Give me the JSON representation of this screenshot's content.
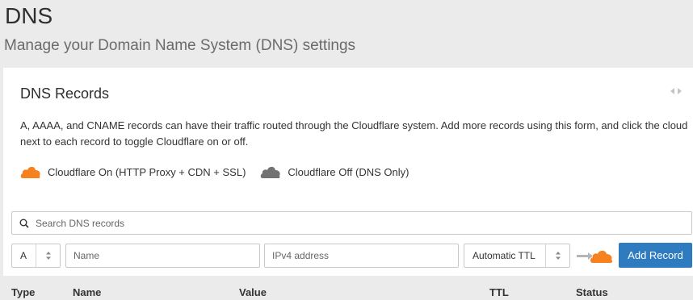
{
  "page": {
    "title": "DNS",
    "subtitle": "Manage your Domain Name System (DNS) settings"
  },
  "card": {
    "title": "DNS Records",
    "description": "A, AAAA, and CNAME records can have their traffic routed through the Cloudflare system. Add more records using this form, and click the cloud next to each record to toggle Cloudflare on or off.",
    "legend_on": "Cloudflare On (HTTP Proxy + CDN + SSL)",
    "legend_off": "Cloudflare Off (DNS Only)"
  },
  "search": {
    "placeholder": "Search DNS records"
  },
  "form": {
    "type_value": "A",
    "name_placeholder": "Name",
    "value_placeholder": "IPv4 address",
    "ttl_value": "Automatic TTL",
    "add_label": "Add Record"
  },
  "table": {
    "headers": [
      "Type",
      "Name",
      "Value",
      "TTL",
      "Status"
    ]
  },
  "colors": {
    "cloud_on": "#f6821f",
    "cloud_off": "#727272",
    "primary": "#2f7bbf"
  },
  "icons": {
    "cloud_on": "cloud-orange-icon",
    "cloud_off": "cloud-gray-icon",
    "search": "search-icon",
    "collapse": "collapse-arrows-icon",
    "select_arrows": "up-down-arrows-icon"
  }
}
